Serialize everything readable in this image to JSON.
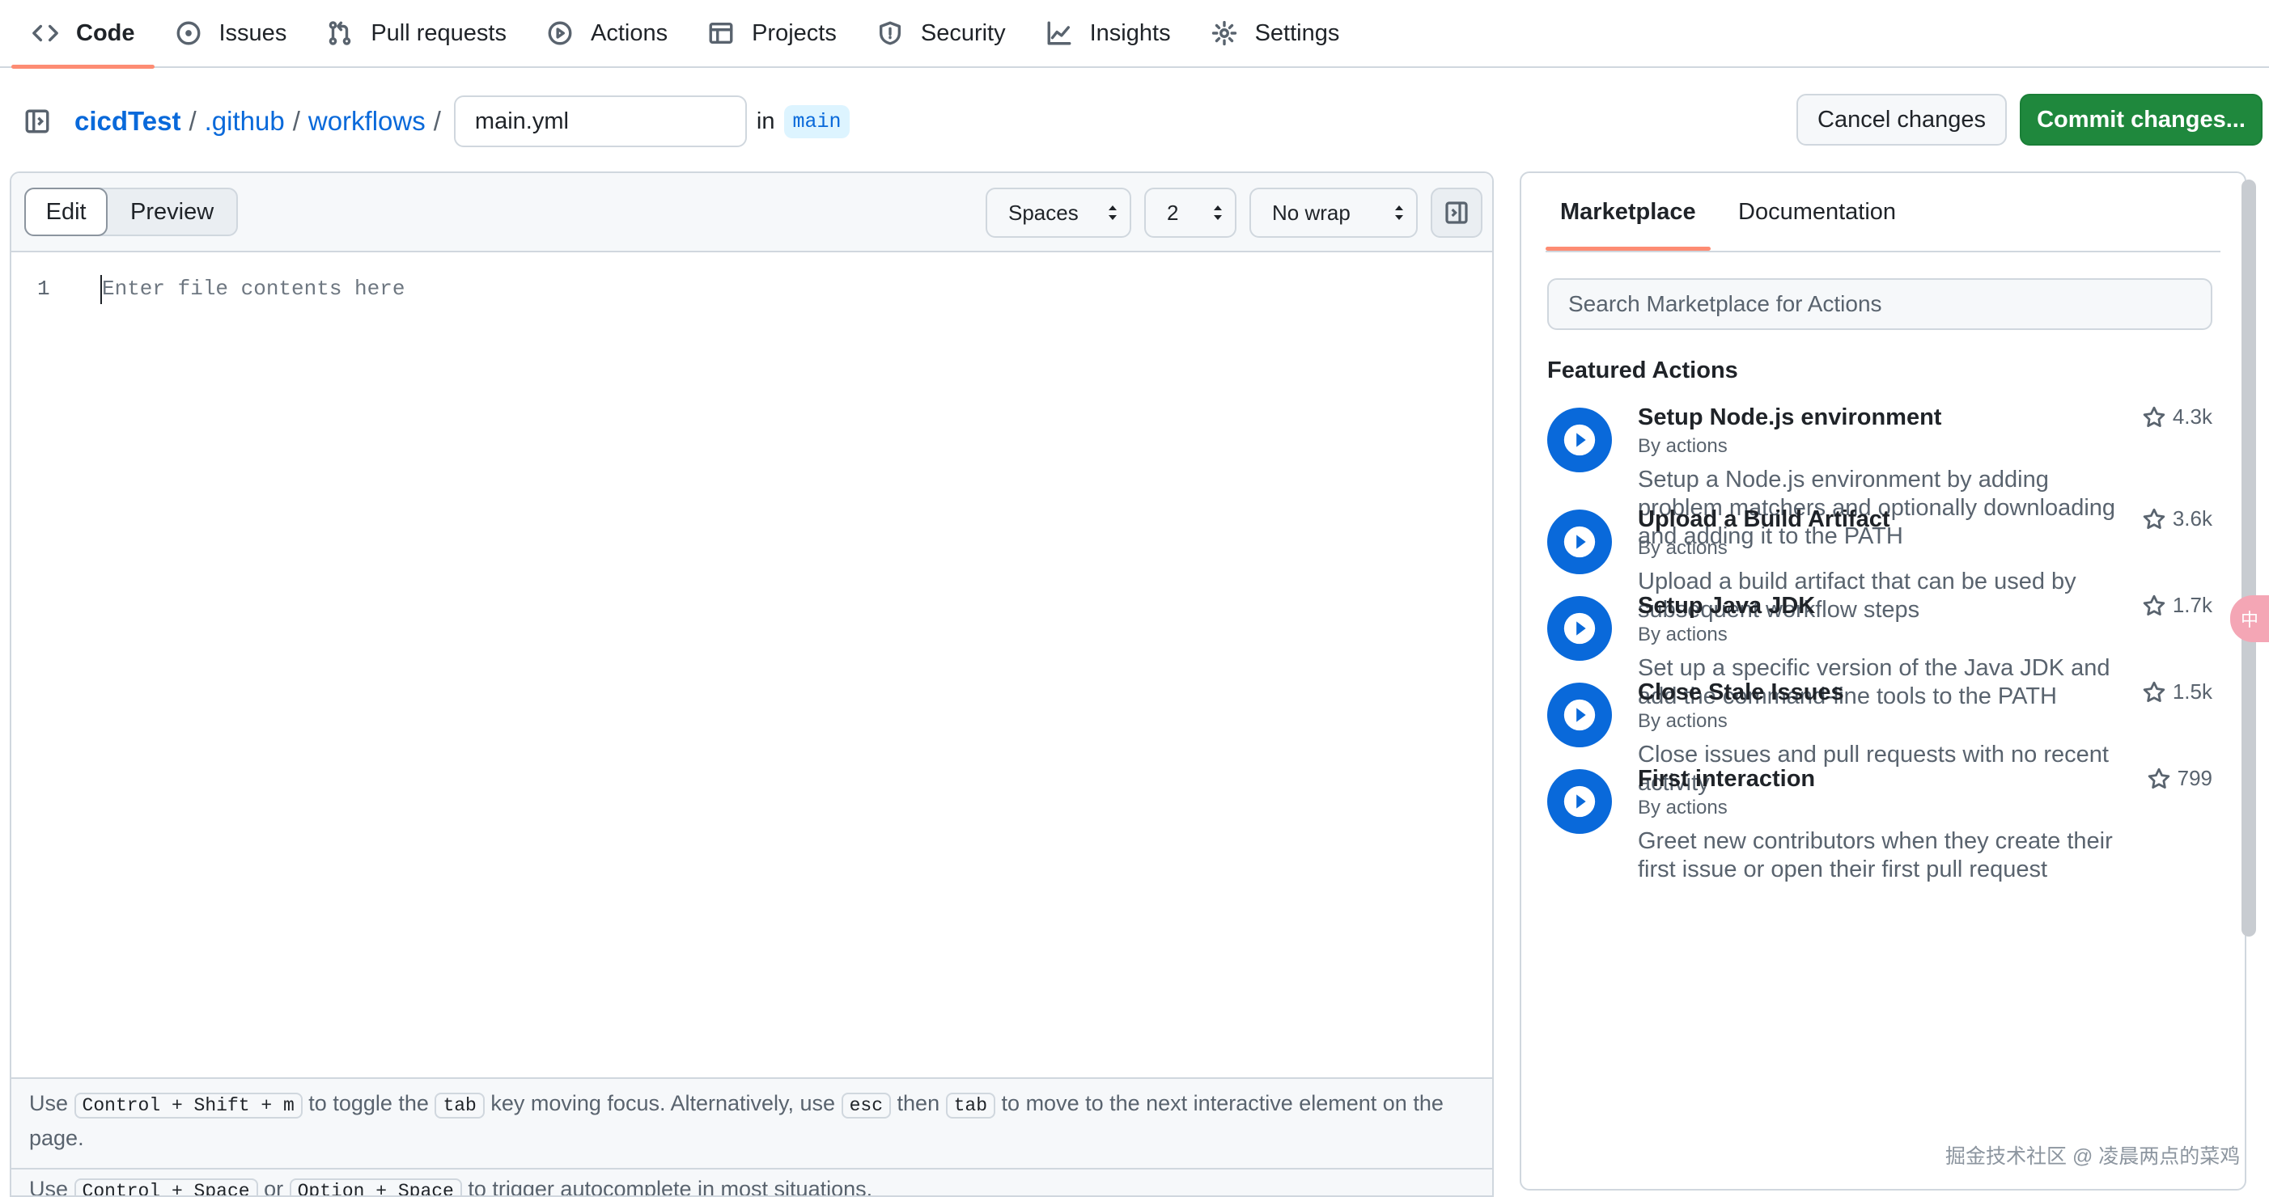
{
  "nav": {
    "tabs": [
      {
        "label": "Code",
        "icon": "code-icon"
      },
      {
        "label": "Issues",
        "icon": "issue-opened-icon"
      },
      {
        "label": "Pull requests",
        "icon": "git-pull-request-icon"
      },
      {
        "label": "Actions",
        "icon": "play-icon"
      },
      {
        "label": "Projects",
        "icon": "table-icon"
      },
      {
        "label": "Security",
        "icon": "shield-icon"
      },
      {
        "label": "Insights",
        "icon": "graph-icon"
      },
      {
        "label": "Settings",
        "icon": "gear-icon"
      }
    ],
    "selected": "Code"
  },
  "breadcrumb": {
    "repo": "cicdTest",
    "dir1": ".github",
    "dir2": "workflows",
    "sep": "/",
    "filename": "main.yml",
    "in_label": "in",
    "branch": "main"
  },
  "actions": {
    "cancel": "Cancel changes",
    "commit": "Commit changes..."
  },
  "editor": {
    "mode_tabs": {
      "edit": "Edit",
      "preview": "Preview"
    },
    "indent_mode": "Spaces",
    "indent_size": "2",
    "wrap_mode": "No wrap",
    "line_number": "1",
    "placeholder": "Enter file contents here",
    "hint1": {
      "p1": "Use",
      "k1": "Control + Shift + m",
      "p2": "to toggle the",
      "k2": "tab",
      "p3": "key moving focus. Alternatively, use",
      "k3": "esc",
      "p4": "then",
      "k4": "tab",
      "p5": "to move to the next interactive element on the page."
    },
    "hint2": {
      "p1": "Use",
      "k1": "Control + Space",
      "p2": "or",
      "k2": "Option + Space",
      "p3": "to trigger autocomplete in most situations."
    }
  },
  "sidepanel": {
    "tabs": {
      "marketplace": "Marketplace",
      "documentation": "Documentation"
    },
    "search_placeholder": "Search Marketplace for Actions",
    "featured_title": "Featured Actions",
    "items": [
      {
        "name": "Setup Node.js environment",
        "by": "By actions",
        "desc": "Setup a Node.js environment by adding problem matchers and optionally downloading and adding it to the PATH",
        "stars": "4.3k"
      },
      {
        "name": "Upload a Build Artifact",
        "by": "By actions",
        "desc": "Upload a build artifact that can be used by subsequent workflow steps",
        "stars": "3.6k"
      },
      {
        "name": "Setup Java JDK",
        "by": "By actions",
        "desc": "Set up a specific version of the Java JDK and add the command-line tools to the PATH",
        "stars": "1.7k"
      },
      {
        "name": "Close Stale Issues",
        "by": "By actions",
        "desc": "Close issues and pull requests with no recent activity",
        "stars": "1.5k"
      },
      {
        "name": "First interaction",
        "by": "By actions",
        "desc": "Greet new contributors when they create their first issue or open their first pull request",
        "stars": "799"
      }
    ]
  },
  "overlay": {
    "badge": "中",
    "watermark": "掘金技术社区 @ 凌晨两点的菜鸡"
  },
  "colors": {
    "accent_link": "#0969da",
    "commit_green": "#1f883d",
    "tab_underline": "#fd8c73",
    "border": "#d0d7de"
  }
}
